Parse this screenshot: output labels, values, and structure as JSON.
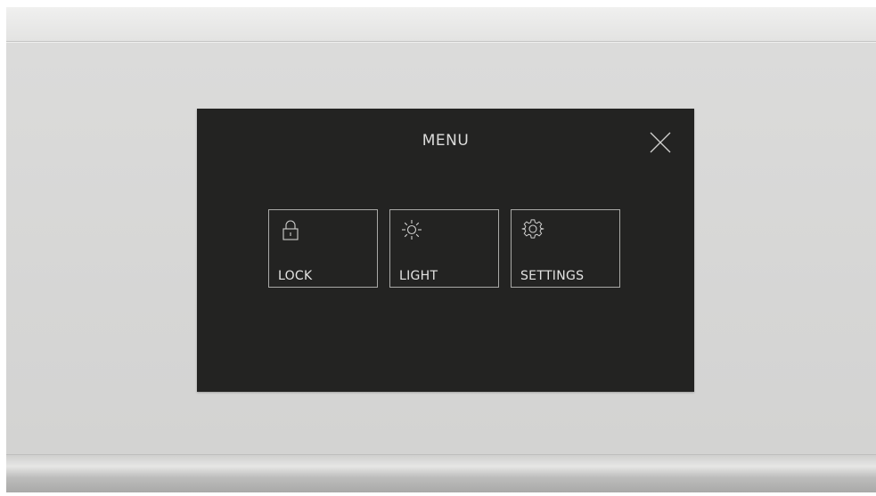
{
  "menu": {
    "title": "MENU",
    "items": [
      {
        "label": "LOCK",
        "icon": "lock-icon"
      },
      {
        "label": "LIGHT",
        "icon": "light-icon"
      },
      {
        "label": "SETTINGS",
        "icon": "gear-icon"
      }
    ]
  },
  "colors": {
    "screen_background": "#232322",
    "text": "#dcdcdb",
    "tile_border": "#a9a9a7",
    "bezel": "#d8d8d7"
  }
}
